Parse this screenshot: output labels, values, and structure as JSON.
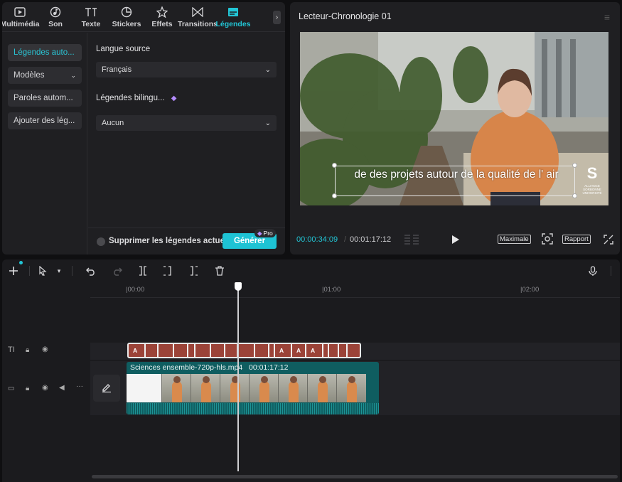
{
  "tabs": [
    {
      "label": "Multimédia",
      "icon": "media-icon"
    },
    {
      "label": "Son",
      "icon": "audio-icon"
    },
    {
      "label": "Texte",
      "icon": "text-icon"
    },
    {
      "label": "Stickers",
      "icon": "sticker-icon"
    },
    {
      "label": "Effets",
      "icon": "effects-icon"
    },
    {
      "label": "Transitions",
      "icon": "transitions-icon"
    },
    {
      "label": "Légendes",
      "icon": "captions-icon"
    }
  ],
  "sidebar": {
    "items": [
      {
        "label": "Légendes auto..."
      },
      {
        "label": "Modèles"
      },
      {
        "label": "Paroles autom..."
      },
      {
        "label": "Ajouter des lég..."
      }
    ]
  },
  "settings": {
    "source_label": "Langue source",
    "source_value": "Français",
    "bilingual_label": "Légendes bilingu...",
    "bilingual_value": "Aucun",
    "checkbox_label": "Supprimer les légendes actuelles",
    "generate_label": "Générer",
    "pro_label": "Pro"
  },
  "player": {
    "title": "Lecteur-Chronologie 01",
    "subtitle": "de des projets autour de la qualité de l' air",
    "logo_text": "ALLIANCE SORBONNE UNIVERSITÉ",
    "current_time": "00:00:34:09",
    "separator": "/",
    "total_time": "00:01:17:12",
    "btn_maximale": "Maximale",
    "btn_rapport": "Rapport"
  },
  "timeline": {
    "ticks": [
      "|00:00",
      "|01:00",
      "|02:00"
    ],
    "clip_name": "Sciences ensemble-720p-hls.mp4",
    "clip_duration": "00:01:17:12",
    "caption_marks": [
      "A",
      "A",
      "A",
      "A"
    ]
  },
  "colors": {
    "accent": "#22c6d6",
    "caption_clip": "#9b4338",
    "video_clip": "#0f5d60"
  }
}
